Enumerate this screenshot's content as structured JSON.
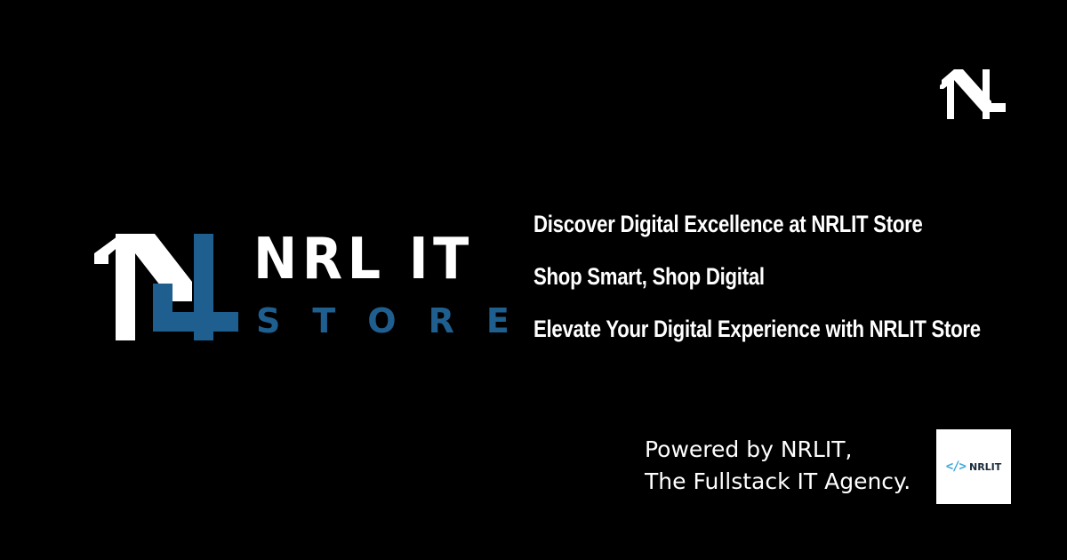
{
  "brand": {
    "wordmark": "NRL IT",
    "subword": "STORE",
    "logo_icon": "nrl-monogram-icon",
    "colors": {
      "background": "#000000",
      "primary_text": "#ffffff",
      "accent_blue": "#1f5f8f",
      "badge_accent": "#3fa8d8"
    }
  },
  "taglines": [
    "Discover Digital Excellence at NRLIT Store",
    "Shop Smart, Shop Digital",
    "Elevate Your Digital Experience with NRLIT Store"
  ],
  "powered_by": {
    "line1": "Powered by NRLIT,",
    "line2": "The Fullstack IT Agency."
  },
  "agency_badge": {
    "icon": "code-brackets-icon",
    "icon_glyph": "</>",
    "name": "NRLIT"
  }
}
